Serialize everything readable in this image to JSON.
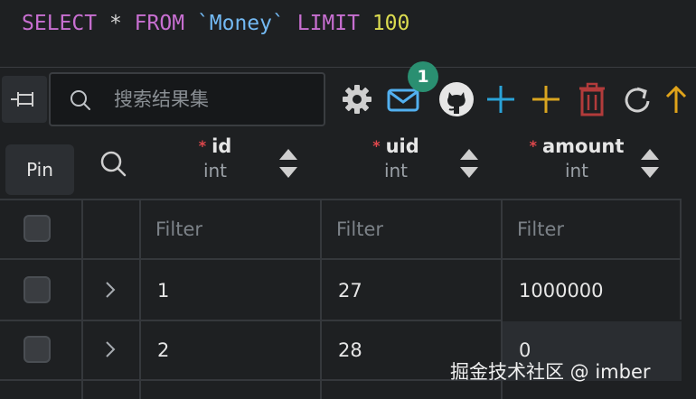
{
  "editor": {
    "kw_select": "SELECT",
    "op_star": "*",
    "kw_from": "FROM",
    "table_ident": "`Money`",
    "kw_limit": "LIMIT",
    "limit_value": "100"
  },
  "toolbar": {
    "pin_tooltip": "Pin",
    "search_placeholder": "搜索结果集",
    "notification_count": "1",
    "icons": [
      "pin-icon",
      "search-icon",
      "gear-icon",
      "mail-icon",
      "github-icon",
      "plus-icon",
      "plus-icon",
      "trash-icon",
      "refresh-icon",
      "arrow-up-icon"
    ],
    "colors": {
      "plus_blue": "#2aa3d8",
      "plus_yellow": "#d9a520",
      "trash_red": "#b23b3b",
      "arrow_yellow": "#e0a31a",
      "mail_blue": "#52b0f0",
      "badge_green": "#2a8f71"
    }
  },
  "table": {
    "columns": [
      {
        "name": "id",
        "type": "int",
        "required": "*"
      },
      {
        "name": "uid",
        "type": "int",
        "required": "*"
      },
      {
        "name": "amount",
        "type": "int",
        "required": "*"
      }
    ],
    "filter_placeholder": "Filter",
    "rows": [
      {
        "id": "1",
        "uid": "27",
        "amount": "1000000"
      },
      {
        "id": "2",
        "uid": "28",
        "amount": "0"
      }
    ]
  },
  "watermark": "掘金技术社区 @ imber"
}
